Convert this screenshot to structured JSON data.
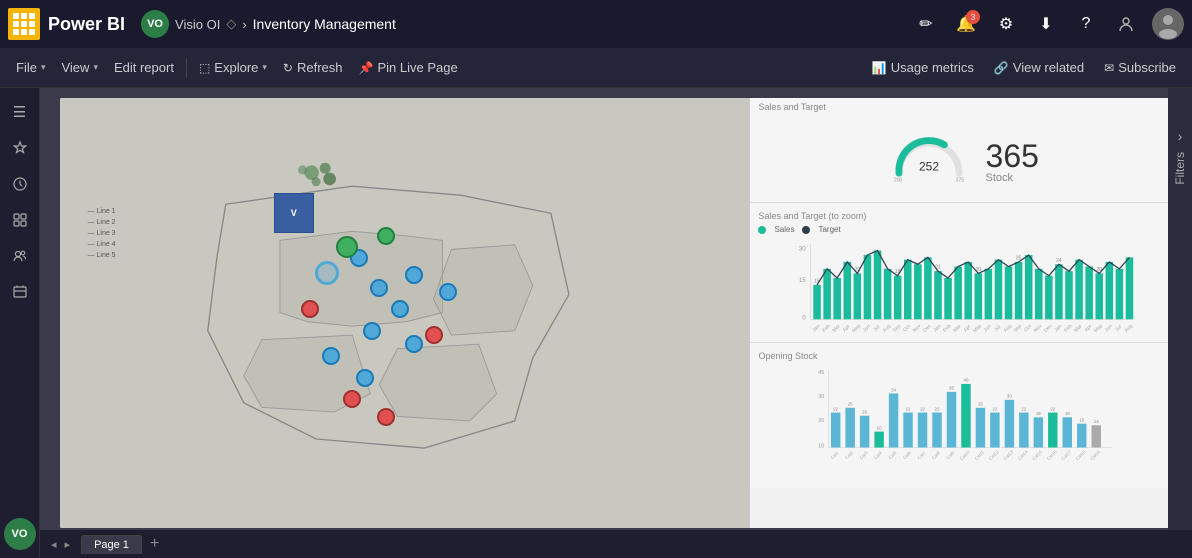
{
  "app": {
    "name": "Power BI",
    "grid_icon_label": "Apps menu"
  },
  "user": {
    "initials": "VO",
    "name": "Visio OI"
  },
  "breadcrumb": {
    "separator": "›",
    "report_name": "Inventory Management"
  },
  "top_nav_icons": {
    "pencil_icon": "✏",
    "bell_icon": "🔔",
    "notification_count": "3",
    "settings_icon": "⚙",
    "download_icon": "⬇",
    "help_icon": "?",
    "share_icon": "👤"
  },
  "toolbar": {
    "file_label": "File",
    "view_label": "View",
    "edit_label": "Edit report",
    "explore_label": "Explore",
    "refresh_label": "Refresh",
    "pin_label": "Pin Live Page",
    "usage_label": "Usage metrics",
    "view_related_label": "View related",
    "subscribe_label": "Subscribe"
  },
  "sidebar": {
    "items": [
      {
        "name": "menu-icon",
        "icon": "☰"
      },
      {
        "name": "favorites-icon",
        "icon": "★"
      },
      {
        "name": "recent-icon",
        "icon": "🕐"
      },
      {
        "name": "apps-icon",
        "icon": "⊞"
      },
      {
        "name": "shared-icon",
        "icon": "👥"
      },
      {
        "name": "workspaces-icon",
        "icon": "🗂"
      }
    ]
  },
  "charts": {
    "gauge": {
      "title": "Sales and Target",
      "center_value": "252",
      "big_number": "365",
      "big_label": "Stock",
      "arc_color": "#1abc9c",
      "arc_bg": "#e0e0e0",
      "min": "200",
      "max": "375"
    },
    "bar_chart": {
      "title": "Sales and Target (to zoom)",
      "legend": [
        {
          "label": "Sales",
          "color": "#1abc9c"
        },
        {
          "label": "Target",
          "color": "#2c3e50"
        }
      ],
      "bars": [
        15,
        22,
        18,
        25,
        20,
        28,
        30,
        22,
        19,
        26,
        24,
        27,
        21,
        18,
        23,
        25,
        20,
        22,
        26,
        23,
        25,
        28,
        22,
        19,
        24,
        21,
        26,
        23,
        20,
        25,
        22,
        27
      ]
    },
    "bottom_chart": {
      "title": "Opening Stock",
      "y_max": "45",
      "bars": [
        {
          "label": "",
          "value": 22
        },
        {
          "label": "",
          "value": 25
        },
        {
          "label": "",
          "value": 20
        },
        {
          "label": "",
          "value": 10
        },
        {
          "label": "",
          "value": 34
        },
        {
          "label": "",
          "value": 22
        },
        {
          "label": "",
          "value": 22
        },
        {
          "label": "",
          "value": 22
        },
        {
          "label": "",
          "value": 35
        },
        {
          "label": "",
          "value": 40
        },
        {
          "label": "",
          "value": 25
        },
        {
          "label": "",
          "value": 22
        },
        {
          "label": "",
          "value": 30
        },
        {
          "label": "",
          "value": 22
        },
        {
          "label": "",
          "value": 19
        },
        {
          "label": "",
          "value": 22
        },
        {
          "label": "",
          "value": 19
        },
        {
          "label": "",
          "value": 15
        },
        {
          "label": "",
          "value": 14
        }
      ]
    }
  },
  "filters": {
    "label": "Filters",
    "chevron": "›"
  },
  "pages": {
    "tabs": [
      {
        "label": "Page 1",
        "active": true
      }
    ]
  }
}
